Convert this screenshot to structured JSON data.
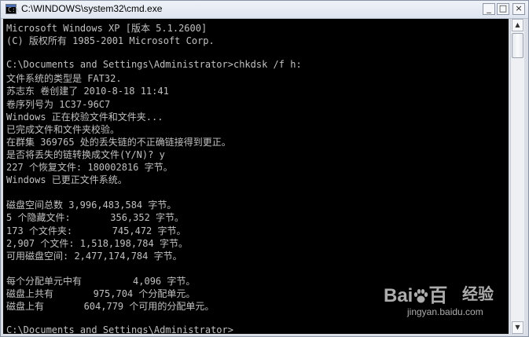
{
  "window": {
    "title": "C:\\WINDOWS\\system32\\cmd.exe",
    "icon_label": "C:\\",
    "controls": {
      "minimize": "_",
      "maximize": "□",
      "close": "×"
    }
  },
  "console": {
    "lines": [
      "Microsoft Windows XP [版本 5.1.2600]",
      "(C) 版权所有 1985-2001 Microsoft Corp.",
      "",
      "C:\\Documents and Settings\\Administrator>chkdsk /f h:",
      "文件系统的类型是 FAT32.",
      "苏志东 卷创建了 2010-8-18 11:41",
      "卷序列号为 1C37-96C7",
      "Windows 正在校验文件和文件夹...",
      "已完成文件和文件夹校验。",
      "在群集 369765 处的丢失链的不正确链接得到更正。",
      "是否将丢失的链转换成文件(Y/N)? y",
      "227 个恢复文件: 180002816 字节。",
      "Windows 已更正文件系统。",
      "",
      "磁盘空间总数 3,996,483,584 字节。",
      "5 个隐藏文件:       356,352 字节。",
      "173 个文件夹:       745,472 字节。",
      "2,907 个文件: 1,518,198,784 字节。",
      "可用磁盘空间: 2,477,174,784 字节。",
      "",
      "每个分配单元中有         4,096 字节。",
      "磁盘上共有       975,704 个分配单元。",
      "磁盘上有       604,779 个可用的分配单元。",
      "",
      "C:\\Documents and Settings\\Administrator>"
    ]
  },
  "scrollbar": {
    "up_arrow": "▲",
    "down_arrow": "▼",
    "position": 0.0
  },
  "watermark": {
    "logo_left": "Bai",
    "logo_right": "百",
    "chinese": "经验",
    "url": "jingyan.baidu.com"
  },
  "colors": {
    "console_bg": "#000000",
    "console_text": "#c0c0c0",
    "titlebar": "#e6eaf1"
  },
  "icons": {
    "title_icon": "cmd-icon",
    "paw": "baidu-paw-icon"
  }
}
